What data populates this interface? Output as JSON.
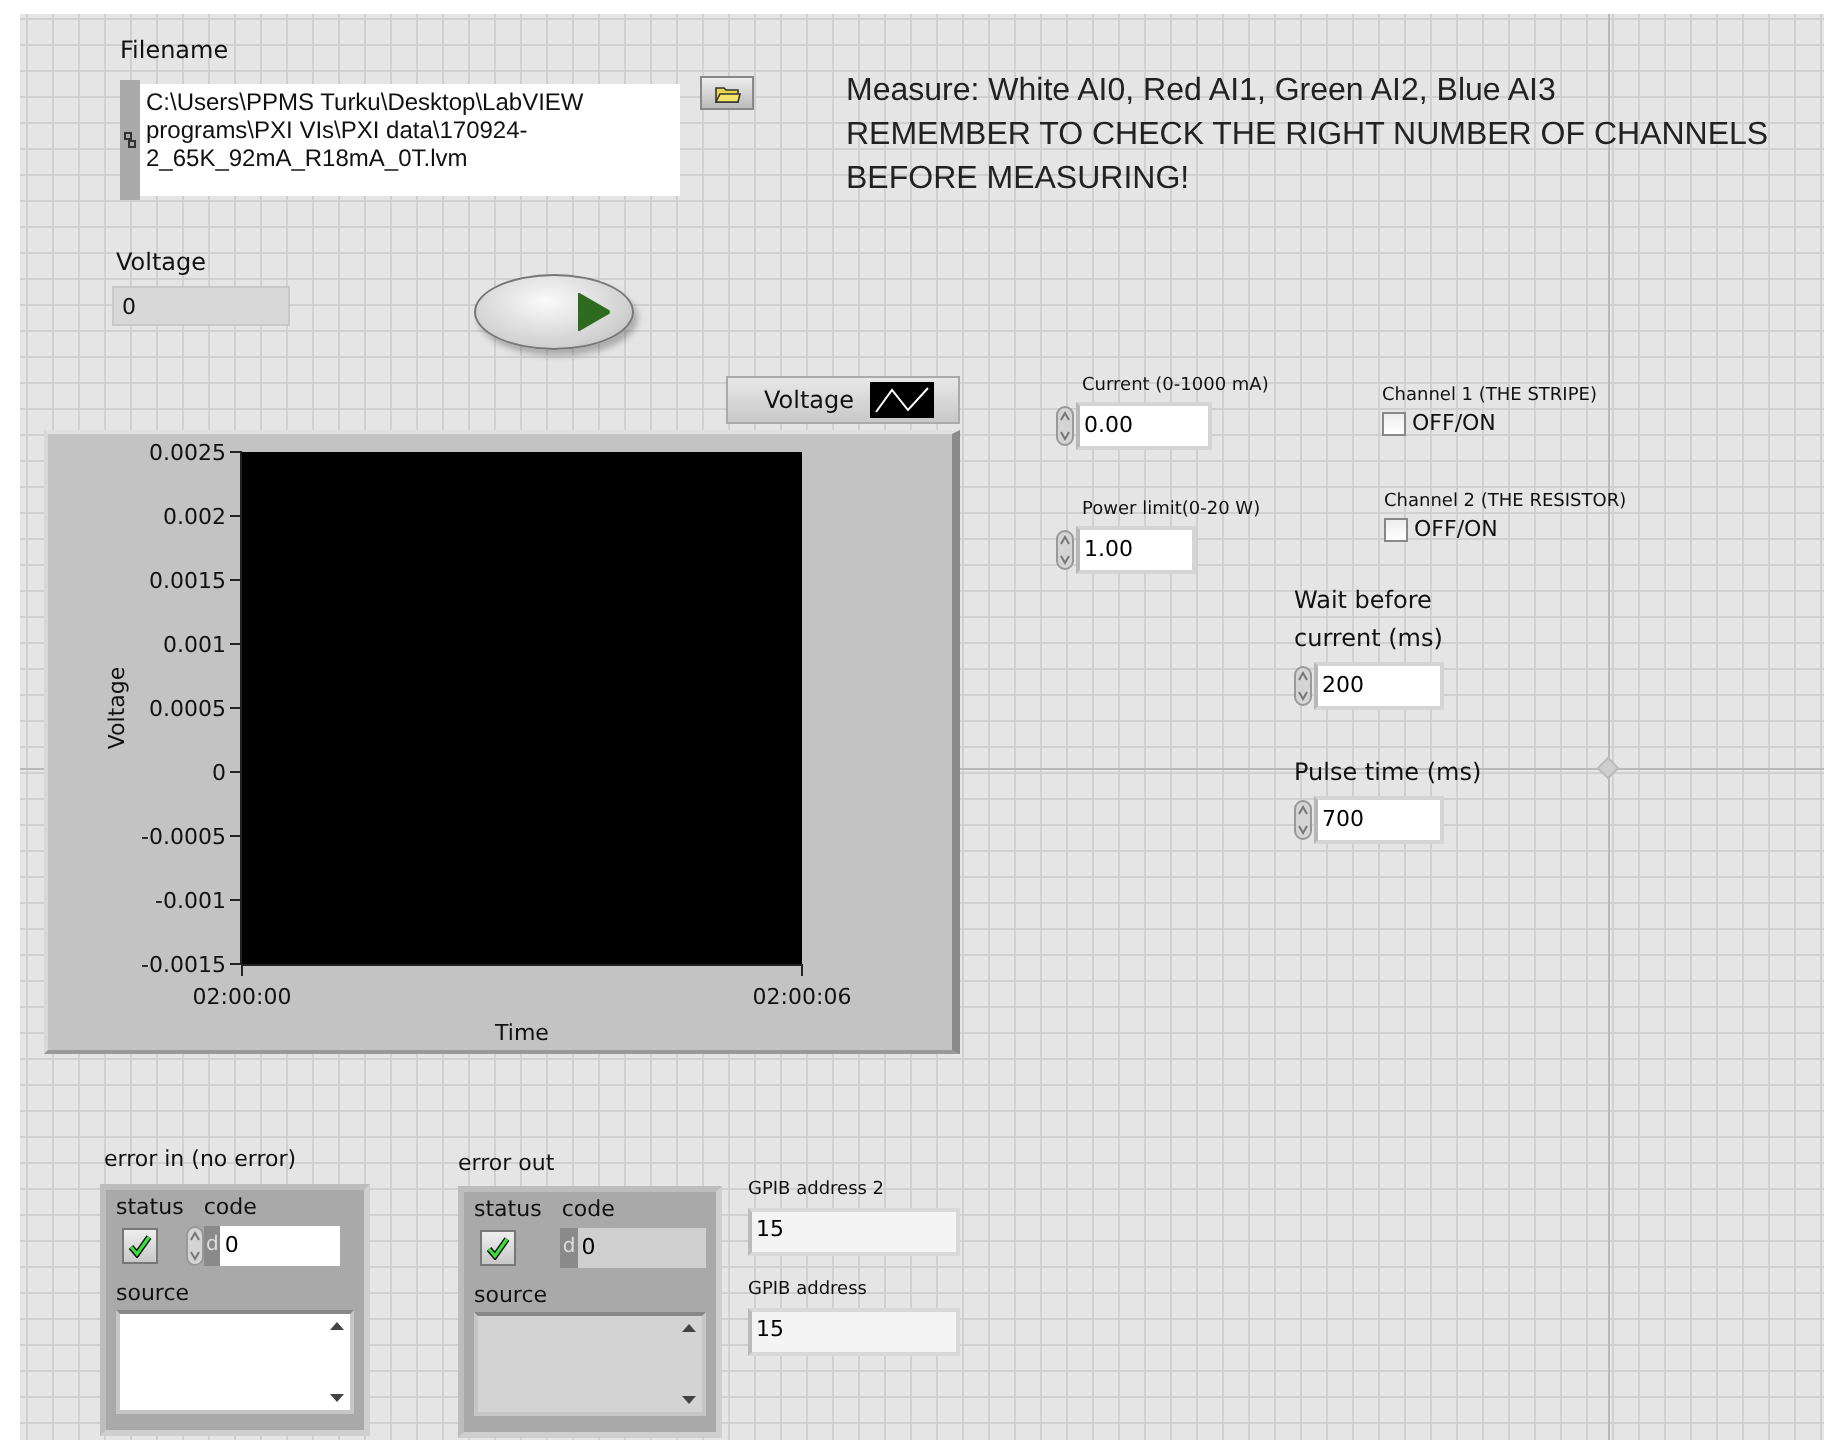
{
  "filename": {
    "label": "Filename",
    "lines": [
      "C:\\Users\\PPMS Turku\\Desktop\\LabVIEW",
      "programs\\PXI VIs\\PXI data\\170924-",
      "2_65K_92mA_R18mA_0T.lvm"
    ]
  },
  "message": {
    "lines": [
      "Measure: White AI0, Red AI1, Green AI2, Blue AI3",
      "REMEMBER TO CHECK THE RIGHT NUMBER OF CHANNELS",
      "BEFORE MEASURING!"
    ]
  },
  "voltage_indicator": {
    "label": "Voltage",
    "value": "0"
  },
  "graph": {
    "legend": "Voltage",
    "chart_data": {
      "type": "line",
      "xlabel": "Time",
      "ylabel": "Voltage",
      "xlim": [
        7200,
        7206
      ],
      "ylim": [
        -0.0015,
        0.0025
      ],
      "xticks": [
        {
          "value": 7200,
          "label": "02:00:00"
        },
        {
          "value": 7206,
          "label": "02:00:06"
        }
      ],
      "yticks": [
        -0.0015,
        -0.001,
        -0.0005,
        0,
        0.0005,
        0.001,
        0.0015,
        0.002,
        0.0025
      ]
    }
  },
  "numeric_controls": [
    {
      "label": "Current (0-1000 mA)",
      "value": "0.00",
      "kind": "small"
    },
    {
      "label": "Power limit(0-20 W)",
      "value": "1.00",
      "kind": "small"
    },
    {
      "label": "Wait before current (ms)",
      "value": "200",
      "kind": "large"
    },
    {
      "label": "Pulse time (ms)",
      "value": "700",
      "kind": "large"
    }
  ],
  "channels": [
    {
      "label": "Channel 1 (THE STRIPE)",
      "option": "OFF/ON",
      "checked": false
    },
    {
      "label": "Channel 2 (THE RESISTOR)",
      "option": "OFF/ON",
      "checked": false
    }
  ],
  "error_clusters": [
    {
      "kind": "control",
      "label": "error in (no error)",
      "status_label": "status",
      "code_label": "code",
      "radix": "d",
      "code": "0",
      "source_label": "source",
      "error": false
    },
    {
      "kind": "indicator",
      "label": "error out",
      "status_label": "status",
      "code_label": "code",
      "radix": "d",
      "code": "0",
      "source_label": "source",
      "error": false
    }
  ],
  "gpib": [
    {
      "label": "GPIB address 2",
      "value": "15"
    },
    {
      "label": "GPIB address",
      "value": "15"
    }
  ]
}
